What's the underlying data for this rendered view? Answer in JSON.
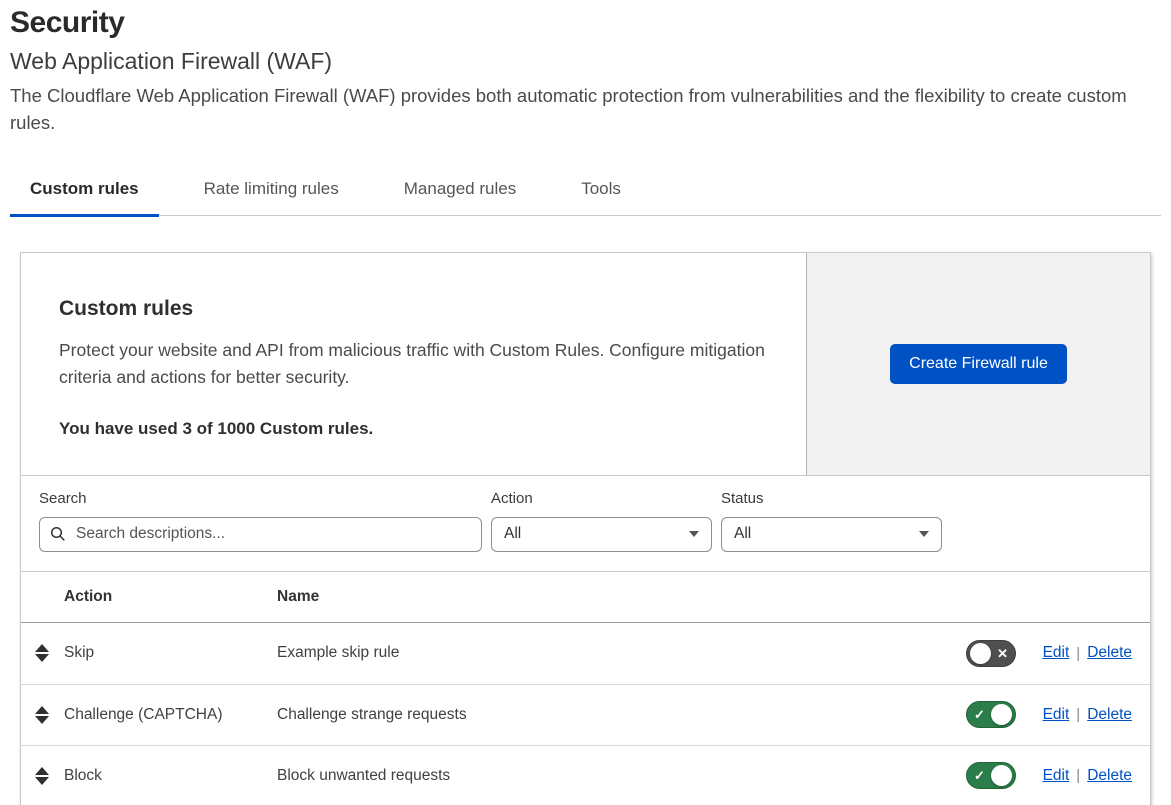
{
  "page": {
    "title": "Security",
    "subtitle": "Web Application Firewall (WAF)",
    "description": "The Cloudflare Web Application Firewall (WAF) provides both automatic protection from vulnerabilities and the flexibility to create custom rules."
  },
  "tabs": [
    {
      "label": "Custom rules",
      "active": true
    },
    {
      "label": "Rate limiting rules",
      "active": false
    },
    {
      "label": "Managed rules",
      "active": false
    },
    {
      "label": "Tools",
      "active": false
    }
  ],
  "card": {
    "heading": "Custom rules",
    "description": "Protect your website and API from malicious traffic with Custom Rules. Configure mitigation criteria and actions for better security.",
    "usage": "You have used 3 of 1000 Custom rules.",
    "create_button": "Create Firewall rule"
  },
  "filters": {
    "search_label": "Search",
    "search_placeholder": "Search descriptions...",
    "action_label": "Action",
    "action_value": "All",
    "status_label": "Status",
    "status_value": "All"
  },
  "table": {
    "columns": [
      "Action",
      "Name"
    ],
    "rows": [
      {
        "action": "Skip",
        "name": "Example skip rule",
        "enabled": false
      },
      {
        "action": "Challenge (CAPTCHA)",
        "name": "Challenge strange requests",
        "enabled": true
      },
      {
        "action": "Block",
        "name": "Block unwanted requests",
        "enabled": true
      }
    ],
    "edit_label": "Edit",
    "delete_label": "Delete"
  },
  "colors": {
    "accent_blue": "#0051c3",
    "toggle_on": "#2b7d4a",
    "toggle_off": "#4f4f4f"
  }
}
